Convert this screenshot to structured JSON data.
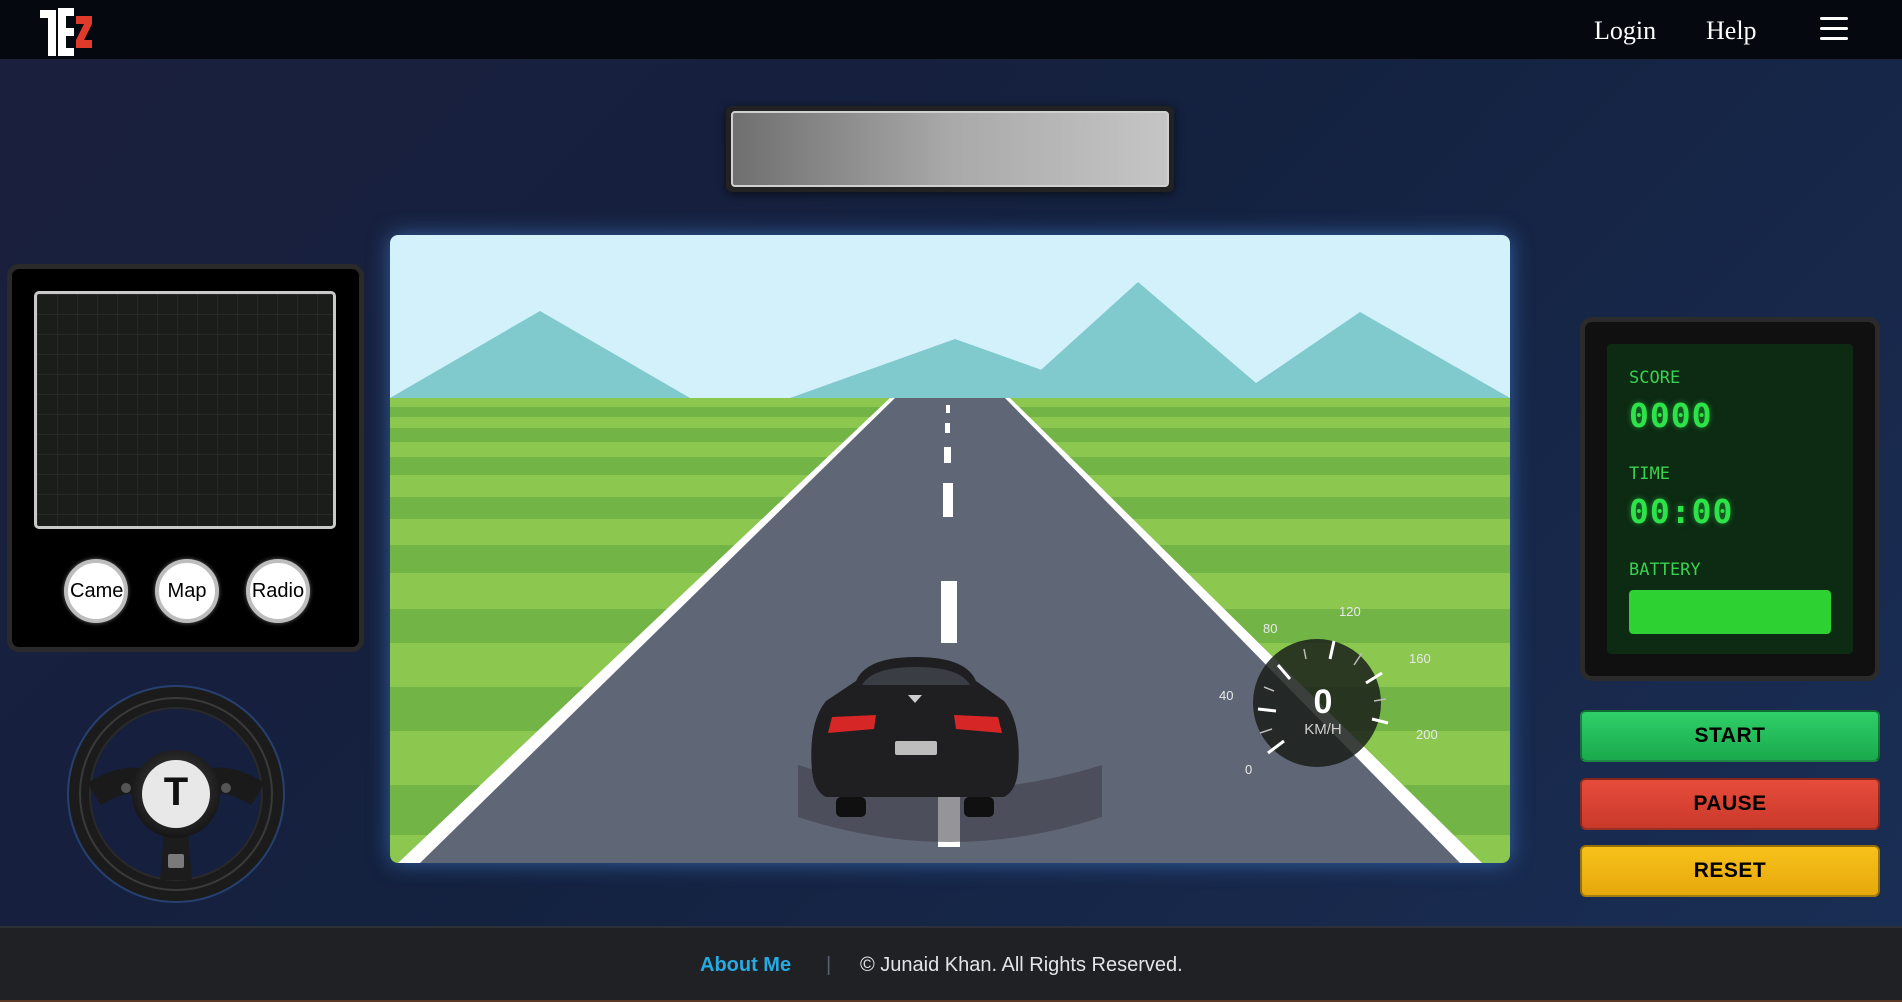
{
  "header": {
    "logo_text": "TEZ",
    "nav": {
      "login": "Login",
      "help": "Help"
    },
    "menu_icon": "hamburger-menu-icon"
  },
  "dashboard": {
    "buttons": {
      "camera": "Camera",
      "map": "Map",
      "radio": "Radio"
    },
    "steering_wheel_logo": "T"
  },
  "game": {
    "speed": "0",
    "speed_unit": "KM/H",
    "speedometer_ticks": [
      "0",
      "40",
      "80",
      "120",
      "160",
      "200"
    ]
  },
  "stats": {
    "score_label": "SCORE",
    "score_value": "0000",
    "time_label": "TIME",
    "time_value": "00:00",
    "battery_label": "BATTERY",
    "battery_level": 1.0
  },
  "controls": {
    "start": "START",
    "pause": "PAUSE",
    "reset": "RESET"
  },
  "footer": {
    "about": "About Me",
    "separator": "|",
    "copyright": "© Junaid Khan. All Rights Reserved."
  },
  "colors": {
    "accent_link": "#27a9e1",
    "start": "#1fbf5a",
    "pause": "#d9412f",
    "reset": "#f0b512",
    "lcd_green": "#2ee34a"
  }
}
